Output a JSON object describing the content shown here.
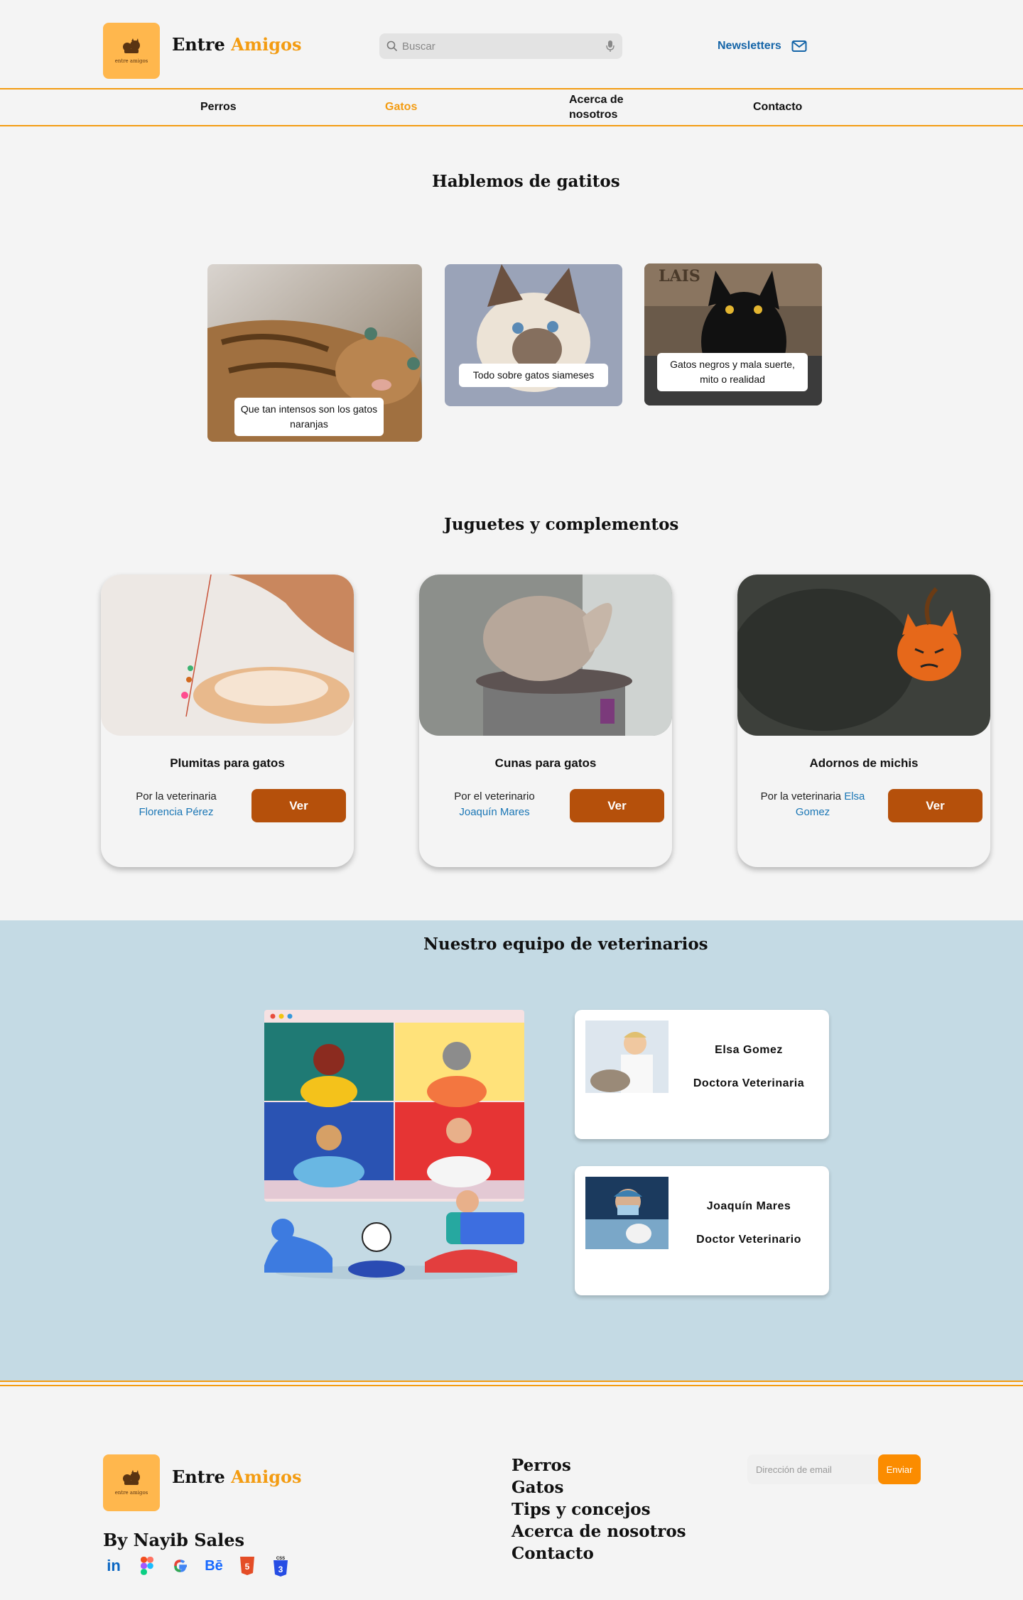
{
  "header": {
    "brand_main": "Entre",
    "brand_accent": "Amigos",
    "logo_text": "entre amigos",
    "search_placeholder": "Buscar",
    "newsletter_label": "Newsletters"
  },
  "nav": {
    "items": [
      {
        "label": "Perros"
      },
      {
        "label": "Gatos",
        "active": true
      },
      {
        "label": "Acerca de nosotros"
      },
      {
        "label": "Contacto"
      }
    ]
  },
  "cats": {
    "title": "Hablemos de gatitos",
    "stories": [
      {
        "caption": "Que tan intensos son los gatos naranjas"
      },
      {
        "caption": "Todo sobre gatos siameses"
      },
      {
        "caption": "Gatos negros y mala suerte, mito o realidad"
      }
    ]
  },
  "toys": {
    "title": "Juguetes y complementos",
    "cards": [
      {
        "title": "Plumitas para gatos",
        "by_prefix": "Por la veterinaria",
        "by_name": "Florencia Pérez",
        "button": "Ver"
      },
      {
        "title": "Cunas para gatos",
        "by_prefix": "Por el veterinario",
        "by_name": "Joaquín Mares",
        "button": "Ver"
      },
      {
        "title": "Adornos de michis",
        "by_prefix": "Por la veterinaria",
        "by_name": "Elsa Gomez",
        "button": "Ver"
      }
    ]
  },
  "team": {
    "title": "Nuestro equipo de veterinarios",
    "vets": [
      {
        "name": "Elsa Gomez",
        "role": "Doctora Veterinaria"
      },
      {
        "name": "Joaquín Mares",
        "role": "Doctor Veterinario"
      }
    ]
  },
  "footer": {
    "brand_main": "Entre",
    "brand_accent": "Amigos",
    "logo_text": "entre amigos",
    "author": "By Nayib Sales",
    "socials": [
      "linkedin-icon",
      "figma-icon",
      "google-icon",
      "behance-icon",
      "html5-icon",
      "css3-icon"
    ],
    "links": [
      "Perros",
      "Gatos",
      "Tips y concejos",
      "Acerca de nosotros",
      "Contacto"
    ],
    "email_placeholder": "Dirección de email",
    "send_label": "Enviar"
  },
  "colors": {
    "accent": "#f39c12",
    "logo_bg": "#ffb74d",
    "button": "#b5500b",
    "link": "#1a76b5",
    "team_bg": "#c4dae4"
  }
}
